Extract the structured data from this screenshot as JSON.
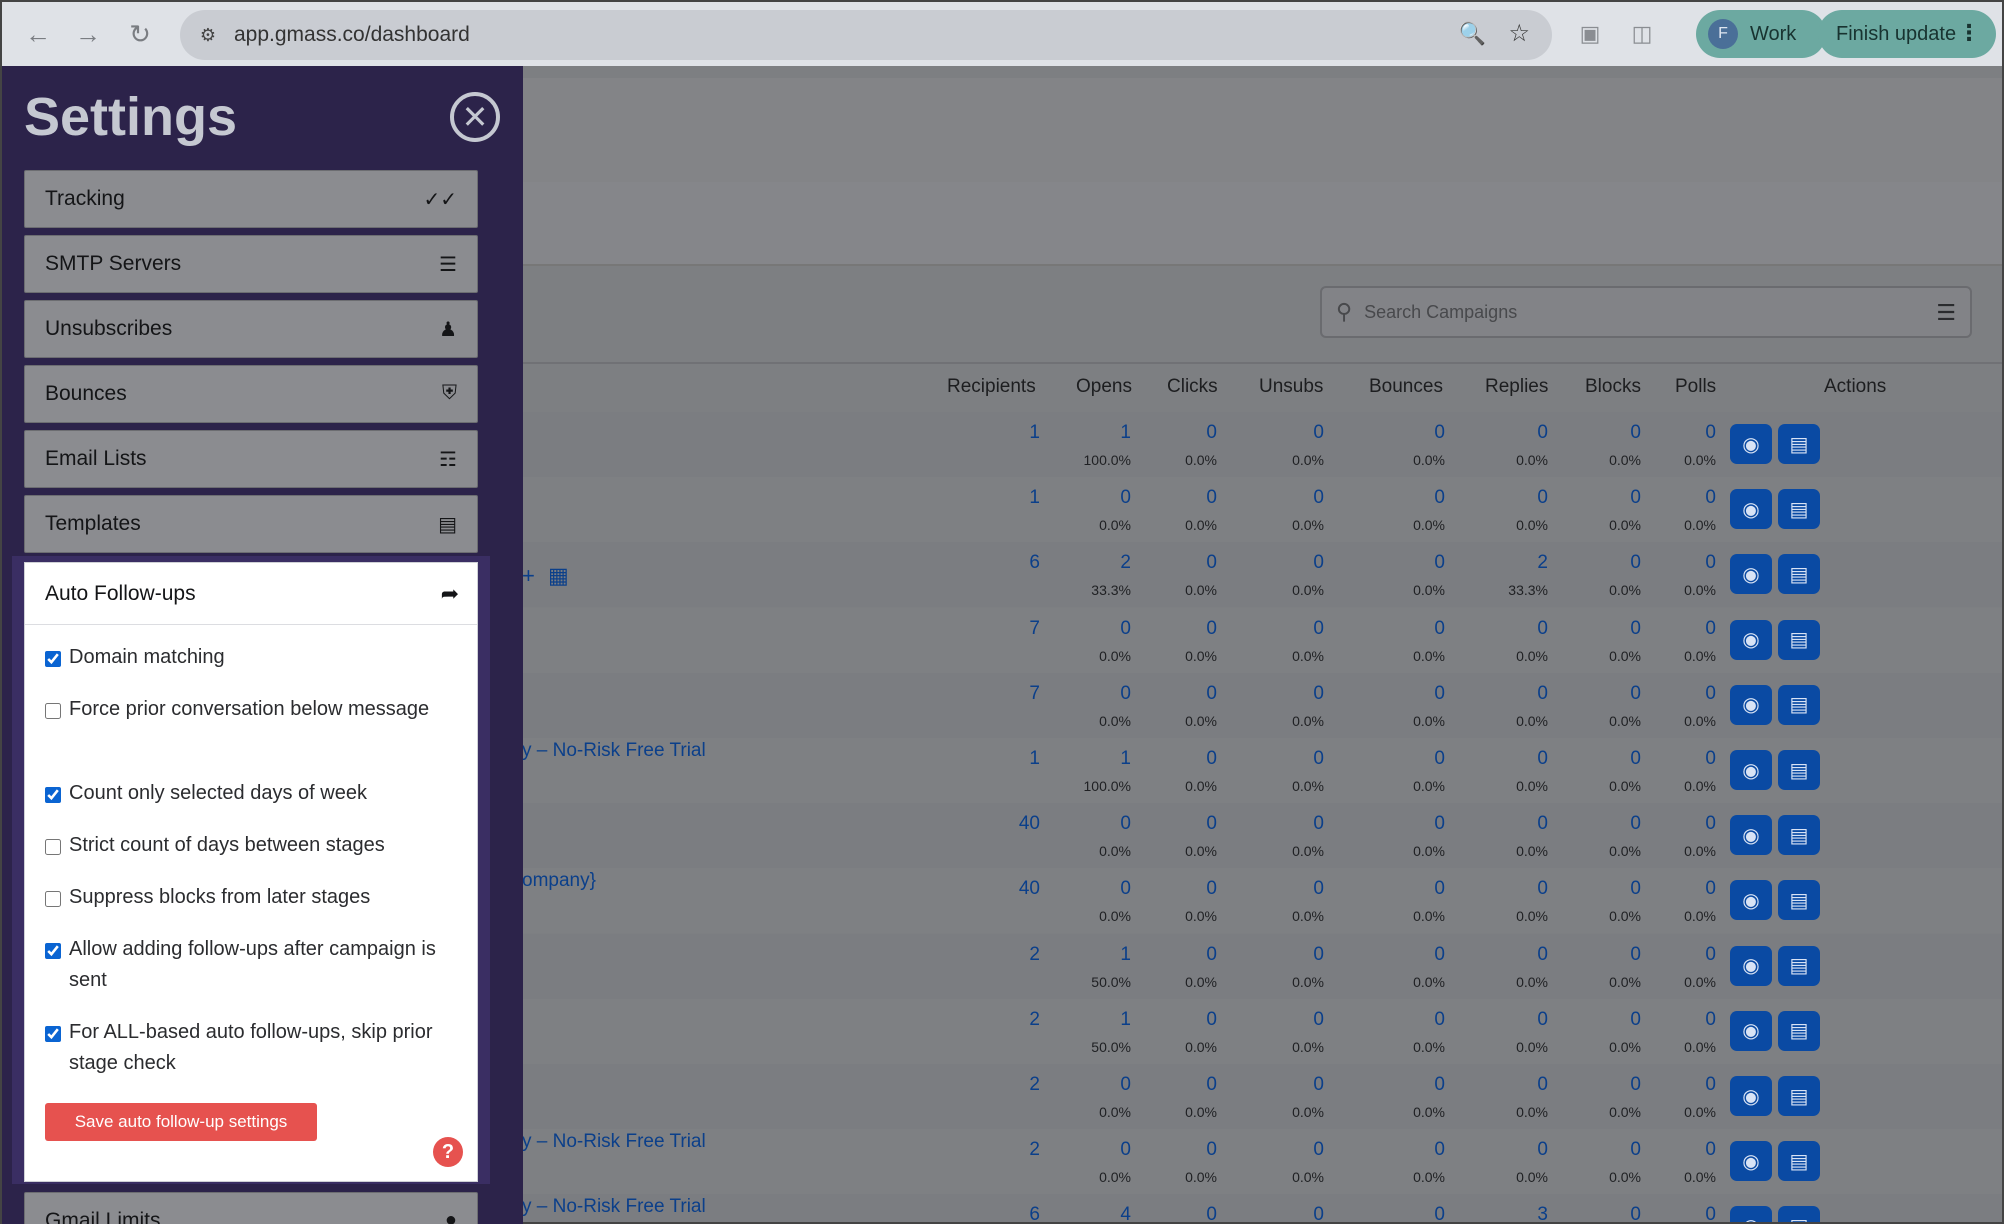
{
  "browser": {
    "url": "app.gmass.co/dashboard",
    "profile_initial": "F",
    "profile_label": "Work",
    "update_label": "Finish update"
  },
  "settings": {
    "title": "Settings",
    "items": [
      {
        "label": "Tracking",
        "icon": "check-double-icon"
      },
      {
        "label": "SMTP Servers",
        "icon": "database-icon"
      },
      {
        "label": "Unsubscribes",
        "icon": "user-gear-icon"
      },
      {
        "label": "Bounces",
        "icon": "shield-icon"
      },
      {
        "label": "Email Lists",
        "icon": "contact-list-icon"
      },
      {
        "label": "Templates",
        "icon": "template-icon"
      }
    ],
    "active": {
      "label": "Auto Follow-ups",
      "icon": "share-icon",
      "options": [
        {
          "text": "Domain matching",
          "checked": true
        },
        {
          "text": "Force prior conversation below message",
          "checked": false
        },
        {
          "text": "Count only selected days of week",
          "checked": true
        },
        {
          "text": "Strict count of days between stages",
          "checked": false
        },
        {
          "text": "Suppress blocks from later stages",
          "checked": false
        },
        {
          "text": "Allow adding follow-ups after campaign is sent",
          "checked": true
        },
        {
          "text": "For ALL-based auto follow-ups, skip prior stage check",
          "checked": true
        }
      ],
      "save_label": "Save auto follow-up settings",
      "help_label": "?"
    },
    "next_item": {
      "label": "Gmail Limits"
    }
  },
  "dashboard": {
    "search_placeholder": "Search Campaigns",
    "columns": [
      "Recipients",
      "Opens",
      "Clicks",
      "Unsubs",
      "Bounces",
      "Replies",
      "Blocks",
      "Polls",
      "Actions"
    ],
    "campaign_links": {
      "row6": "y – No-Risk Free Trial",
      "row8": "ompany}",
      "row12": "y – No-Risk Free Trial",
      "row13": "y – No-Risk Free Trial"
    },
    "rows": [
      {
        "recipients": "1",
        "opens": "1",
        "opens_pct": "100.0%",
        "clicks": "0",
        "clicks_pct": "0.0%",
        "unsubs": "0",
        "unsubs_pct": "0.0%",
        "bounces": "0",
        "bounces_pct": "0.0%",
        "replies": "0",
        "replies_pct": "0.0%",
        "blocks": "0",
        "blocks_pct": "0.0%",
        "polls": "0",
        "polls_pct": "0.0%"
      },
      {
        "recipients": "1",
        "opens": "0",
        "opens_pct": "0.0%",
        "clicks": "0",
        "clicks_pct": "0.0%",
        "unsubs": "0",
        "unsubs_pct": "0.0%",
        "bounces": "0",
        "bounces_pct": "0.0%",
        "replies": "0",
        "replies_pct": "0.0%",
        "blocks": "0",
        "blocks_pct": "0.0%",
        "polls": "0",
        "polls_pct": "0.0%"
      },
      {
        "recipients": "6",
        "opens": "2",
        "opens_pct": "33.3%",
        "clicks": "0",
        "clicks_pct": "0.0%",
        "unsubs": "0",
        "unsubs_pct": "0.0%",
        "bounces": "0",
        "bounces_pct": "0.0%",
        "replies": "2",
        "replies_pct": "33.3%",
        "blocks": "0",
        "blocks_pct": "0.0%",
        "polls": "0",
        "polls_pct": "0.0%"
      },
      {
        "recipients": "7",
        "opens": "0",
        "opens_pct": "0.0%",
        "clicks": "0",
        "clicks_pct": "0.0%",
        "unsubs": "0",
        "unsubs_pct": "0.0%",
        "bounces": "0",
        "bounces_pct": "0.0%",
        "replies": "0",
        "replies_pct": "0.0%",
        "blocks": "0",
        "blocks_pct": "0.0%",
        "polls": "0",
        "polls_pct": "0.0%"
      },
      {
        "recipients": "7",
        "opens": "0",
        "opens_pct": "0.0%",
        "clicks": "0",
        "clicks_pct": "0.0%",
        "unsubs": "0",
        "unsubs_pct": "0.0%",
        "bounces": "0",
        "bounces_pct": "0.0%",
        "replies": "0",
        "replies_pct": "0.0%",
        "blocks": "0",
        "blocks_pct": "0.0%",
        "polls": "0",
        "polls_pct": "0.0%"
      },
      {
        "recipients": "1",
        "opens": "1",
        "opens_pct": "100.0%",
        "clicks": "0",
        "clicks_pct": "0.0%",
        "unsubs": "0",
        "unsubs_pct": "0.0%",
        "bounces": "0",
        "bounces_pct": "0.0%",
        "replies": "0",
        "replies_pct": "0.0%",
        "blocks": "0",
        "blocks_pct": "0.0%",
        "polls": "0",
        "polls_pct": "0.0%"
      },
      {
        "recipients": "40",
        "opens": "0",
        "opens_pct": "0.0%",
        "clicks": "0",
        "clicks_pct": "0.0%",
        "unsubs": "0",
        "unsubs_pct": "0.0%",
        "bounces": "0",
        "bounces_pct": "0.0%",
        "replies": "0",
        "replies_pct": "0.0%",
        "blocks": "0",
        "blocks_pct": "0.0%",
        "polls": "0",
        "polls_pct": "0.0%"
      },
      {
        "recipients": "40",
        "opens": "0",
        "opens_pct": "0.0%",
        "clicks": "0",
        "clicks_pct": "0.0%",
        "unsubs": "0",
        "unsubs_pct": "0.0%",
        "bounces": "0",
        "bounces_pct": "0.0%",
        "replies": "0",
        "replies_pct": "0.0%",
        "blocks": "0",
        "blocks_pct": "0.0%",
        "polls": "0",
        "polls_pct": "0.0%"
      },
      {
        "recipients": "2",
        "opens": "1",
        "opens_pct": "50.0%",
        "clicks": "0",
        "clicks_pct": "0.0%",
        "unsubs": "0",
        "unsubs_pct": "0.0%",
        "bounces": "0",
        "bounces_pct": "0.0%",
        "replies": "0",
        "replies_pct": "0.0%",
        "blocks": "0",
        "blocks_pct": "0.0%",
        "polls": "0",
        "polls_pct": "0.0%"
      },
      {
        "recipients": "2",
        "opens": "1",
        "opens_pct": "50.0%",
        "clicks": "0",
        "clicks_pct": "0.0%",
        "unsubs": "0",
        "unsubs_pct": "0.0%",
        "bounces": "0",
        "bounces_pct": "0.0%",
        "replies": "0",
        "replies_pct": "0.0%",
        "blocks": "0",
        "blocks_pct": "0.0%",
        "polls": "0",
        "polls_pct": "0.0%"
      },
      {
        "recipients": "2",
        "opens": "0",
        "opens_pct": "0.0%",
        "clicks": "0",
        "clicks_pct": "0.0%",
        "unsubs": "0",
        "unsubs_pct": "0.0%",
        "bounces": "0",
        "bounces_pct": "0.0%",
        "replies": "0",
        "replies_pct": "0.0%",
        "blocks": "0",
        "blocks_pct": "0.0%",
        "polls": "0",
        "polls_pct": "0.0%"
      },
      {
        "recipients": "2",
        "opens": "0",
        "opens_pct": "0.0%",
        "clicks": "0",
        "clicks_pct": "0.0%",
        "unsubs": "0",
        "unsubs_pct": "0.0%",
        "bounces": "0",
        "bounces_pct": "0.0%",
        "replies": "0",
        "replies_pct": "0.0%",
        "blocks": "0",
        "blocks_pct": "0.0%",
        "polls": "0",
        "polls_pct": "0.0%"
      },
      {
        "recipients": "6",
        "opens": "4",
        "opens_pct": "",
        "clicks": "0",
        "clicks_pct": "",
        "unsubs": "0",
        "unsubs_pct": "",
        "bounces": "0",
        "bounces_pct": "",
        "replies": "3",
        "replies_pct": "",
        "blocks": "0",
        "blocks_pct": "",
        "polls": "0",
        "polls_pct": ""
      }
    ]
  }
}
